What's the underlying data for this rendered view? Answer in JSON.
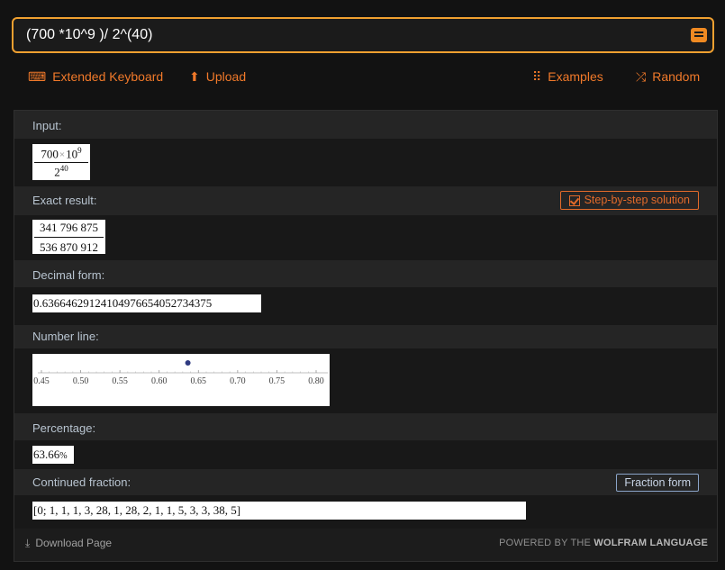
{
  "search": {
    "query": "(700 *10^9 )/ 2^(40)"
  },
  "toolbar": {
    "extended_keyboard": "Extended Keyboard",
    "upload": "Upload",
    "examples": "Examples",
    "random": "Random"
  },
  "pods": {
    "input": {
      "title": "Input:",
      "numerator_base": "700",
      "times": "×",
      "numerator_power_base": "10",
      "numerator_exponent": "9",
      "denominator_base": "2",
      "denominator_exponent": "40"
    },
    "exact": {
      "title": "Exact result:",
      "step_button": "Step-by-step solution",
      "numerator": "341 796 875",
      "denominator": "536 870 912"
    },
    "decimal": {
      "title": "Decimal form:",
      "value": "0.63664629124104976654052734375"
    },
    "number_line": {
      "title": "Number line:",
      "ticks": [
        "0.45",
        "0.50",
        "0.55",
        "0.60",
        "0.65",
        "0.70",
        "0.75",
        "0.80"
      ],
      "axis_min": 0.45,
      "axis_max": 0.8,
      "point": 0.6366
    },
    "percentage": {
      "title": "Percentage:",
      "value": "63.66",
      "unit": "%"
    },
    "continued": {
      "title": "Continued fraction:",
      "button": "Fraction form",
      "value": "[0; 1, 1, 1, 3, 28, 1, 28, 2, 1, 1, 5, 3, 3, 38, 5]"
    }
  },
  "footer": {
    "download": "Download Page",
    "powered_prefix": "POWERED BY THE",
    "powered_brand": "WOLFRAM LANGUAGE"
  },
  "colors": {
    "accent": "#f08a22",
    "search_border": "#f0a030",
    "point": "#2e3a80"
  }
}
